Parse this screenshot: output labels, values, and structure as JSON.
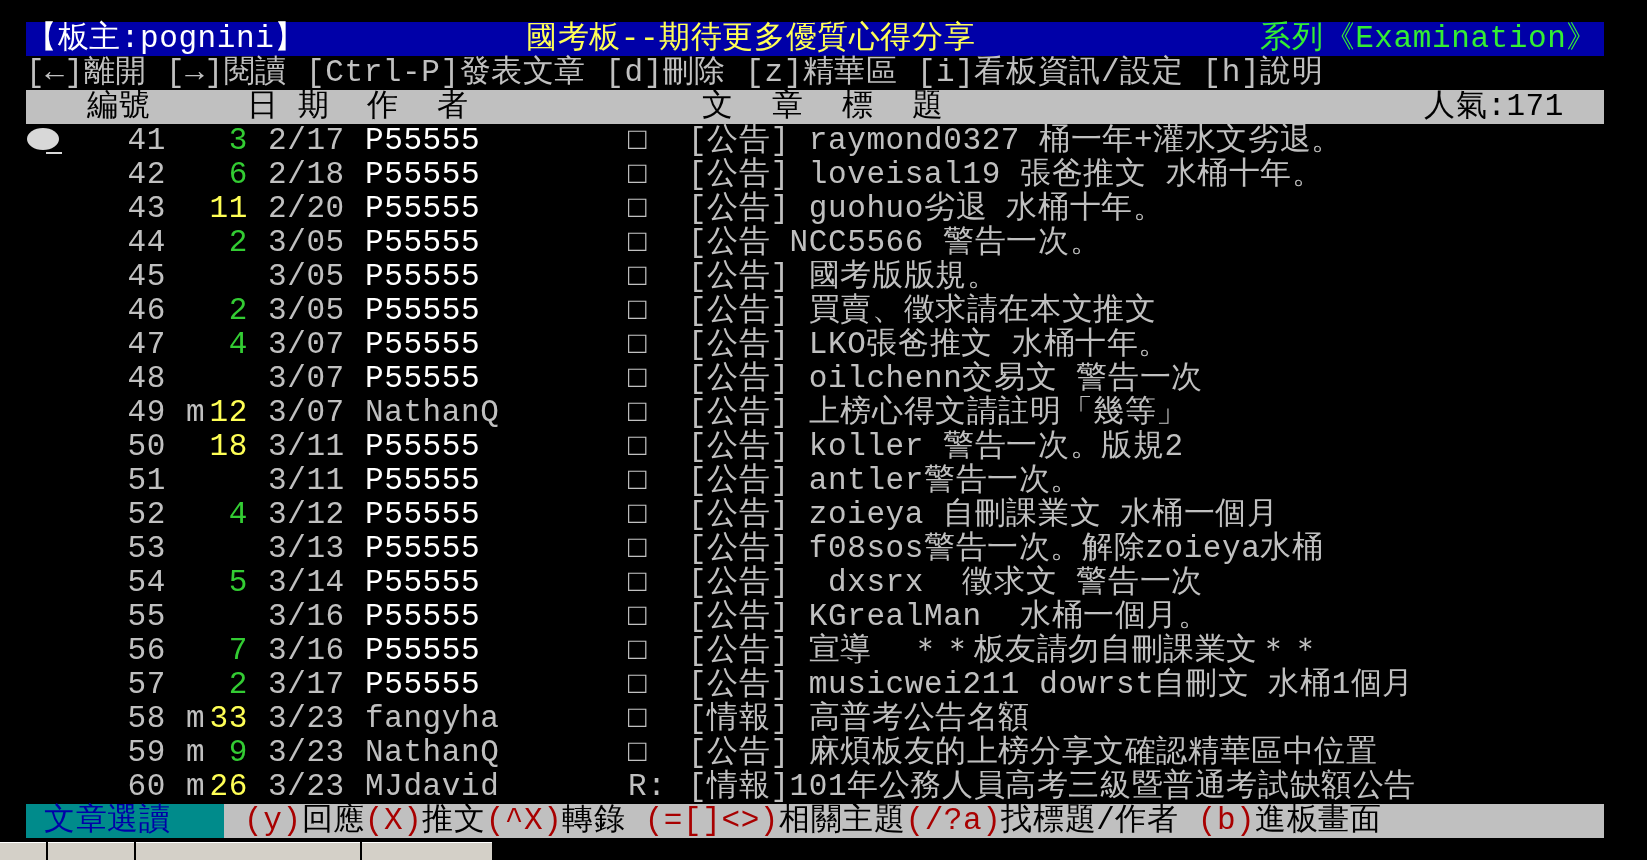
{
  "header": {
    "moderator": "【板主:pognini】",
    "board_title": "國考板--期待更多優質心得分享",
    "series": "系列《Examination》"
  },
  "menu": "[←]離開 [→]閱讀 [Ctrl-P]發表文章 [d]刪除 [z]精華區 [i]看板資訊/設定 [h]說明",
  "columns": {
    "number": "編號",
    "date": "日 期",
    "author": "作  者",
    "title": "文  章  標  題",
    "popularity": "人氣:171"
  },
  "rows": [
    {
      "number": "41",
      "mark": "",
      "count": "3",
      "color": "#33cc33",
      "date": "2/17",
      "author": "P55555",
      "author_bright": true,
      "status": "□",
      "title": "[公告] raymond0327 桶一年+灌水文劣退。",
      "selected": true
    },
    {
      "number": "42",
      "mark": "",
      "count": "6",
      "color": "#33cc33",
      "date": "2/18",
      "author": "P55555",
      "author_bright": true,
      "status": "□",
      "title": "[公告] loveisal19 張爸推文 水桶十年。",
      "selected": false
    },
    {
      "number": "43",
      "mark": "",
      "count": "11",
      "color": "#ffff55",
      "date": "2/20",
      "author": "P55555",
      "author_bright": true,
      "status": "□",
      "title": "[公告] guohuo劣退 水桶十年。",
      "selected": false
    },
    {
      "number": "44",
      "mark": "",
      "count": "2",
      "color": "#33cc33",
      "date": "3/05",
      "author": "P55555",
      "author_bright": true,
      "status": "□",
      "title": "[公告 NCC5566 警告一次。",
      "selected": false
    },
    {
      "number": "45",
      "mark": "",
      "count": "",
      "date": "3/05",
      "author": "P55555",
      "author_bright": true,
      "status": "□",
      "title": "[公告] 國考版版規。",
      "selected": false
    },
    {
      "number": "46",
      "mark": "",
      "count": "2",
      "color": "#33cc33",
      "date": "3/05",
      "author": "P55555",
      "author_bright": true,
      "status": "□",
      "title": "[公告] 買賣、徵求請在本文推文",
      "selected": false
    },
    {
      "number": "47",
      "mark": "",
      "count": "4",
      "color": "#33cc33",
      "date": "3/07",
      "author": "P55555",
      "author_bright": true,
      "status": "□",
      "title": "[公告] LKO張爸推文 水桶十年。",
      "selected": false
    },
    {
      "number": "48",
      "mark": "",
      "count": "",
      "date": "3/07",
      "author": "P55555",
      "author_bright": true,
      "status": "□",
      "title": "[公告] oilchenn交易文 警告一次",
      "selected": false
    },
    {
      "number": "49",
      "mark": "m",
      "count": "12",
      "color": "#ffff55",
      "date": "3/07",
      "author": "NathanQ",
      "author_bright": false,
      "status": "□",
      "title": "[公告] 上榜心得文請註明「幾等」",
      "selected": false
    },
    {
      "number": "50",
      "mark": "",
      "count": "18",
      "color": "#ffff55",
      "date": "3/11",
      "author": "P55555",
      "author_bright": true,
      "status": "□",
      "title": "[公告] koller 警告一次。版規2",
      "selected": false
    },
    {
      "number": "51",
      "mark": "",
      "count": "",
      "date": "3/11",
      "author": "P55555",
      "author_bright": true,
      "status": "□",
      "title": "[公告] antler警告一次。",
      "selected": false
    },
    {
      "number": "52",
      "mark": "",
      "count": "4",
      "color": "#33cc33",
      "date": "3/12",
      "author": "P55555",
      "author_bright": true,
      "status": "□",
      "title": "[公告] zoieya 自刪課業文 水桶一個月",
      "selected": false
    },
    {
      "number": "53",
      "mark": "",
      "count": "",
      "date": "3/13",
      "author": "P55555",
      "author_bright": true,
      "status": "□",
      "title": "[公告] f08sos警告一次。解除zoieya水桶",
      "selected": false
    },
    {
      "number": "54",
      "mark": "",
      "count": "5",
      "color": "#33cc33",
      "date": "3/14",
      "author": "P55555",
      "author_bright": true,
      "status": "□",
      "title": "[公告]  dxsrx  徵求文 警告一次",
      "selected": false
    },
    {
      "number": "55",
      "mark": "",
      "count": "",
      "date": "3/16",
      "author": "P55555",
      "author_bright": true,
      "status": "□",
      "title": "[公告] KGrealMan  水桶一個月。",
      "selected": false
    },
    {
      "number": "56",
      "mark": "",
      "count": "7",
      "color": "#33cc33",
      "date": "3/16",
      "author": "P55555",
      "author_bright": true,
      "status": "□",
      "title": "[公告] 宣導  ＊＊板友請勿自刪課業文＊＊",
      "selected": false
    },
    {
      "number": "57",
      "mark": "",
      "count": "2",
      "color": "#33cc33",
      "date": "3/17",
      "author": "P55555",
      "author_bright": true,
      "status": "□",
      "title": "[公告] musicwei211 dowrst自刪文 水桶1個月",
      "selected": false
    },
    {
      "number": "58",
      "mark": "m",
      "count": "33",
      "color": "#ffff55",
      "date": "3/23",
      "author": "fangyha",
      "author_bright": false,
      "status": "□",
      "title": "[情報] 高普考公告名額",
      "selected": false
    },
    {
      "number": "59",
      "mark": "m",
      "count": "9",
      "color": "#33cc33",
      "date": "3/23",
      "author": "NathanQ",
      "author_bright": false,
      "status": "□",
      "title": "[公告] 麻煩板友的上榜分享文確認精華區中位置",
      "selected": false
    },
    {
      "number": "60",
      "mark": "m",
      "count": "26",
      "color": "#ffff55",
      "date": "3/23",
      "author": "MJdavid",
      "author_bright": false,
      "status": "R:",
      "title": "[情報]101年公務人員高考三級暨普通考試缺額公告",
      "selected": false
    }
  ],
  "footer": {
    "mode": "文章選讀",
    "commands": [
      {
        "key": "(y)",
        "label": "回應"
      },
      {
        "key": "(X)",
        "label": "推文"
      },
      {
        "key": "(^X)",
        "label": "轉錄"
      },
      {
        "key": "(=[]<>)",
        "label": "相關主題"
      },
      {
        "key": "(/?a)",
        "label": "找標題/作者"
      },
      {
        "key": "(b)",
        "label": "進板畫面"
      }
    ]
  }
}
